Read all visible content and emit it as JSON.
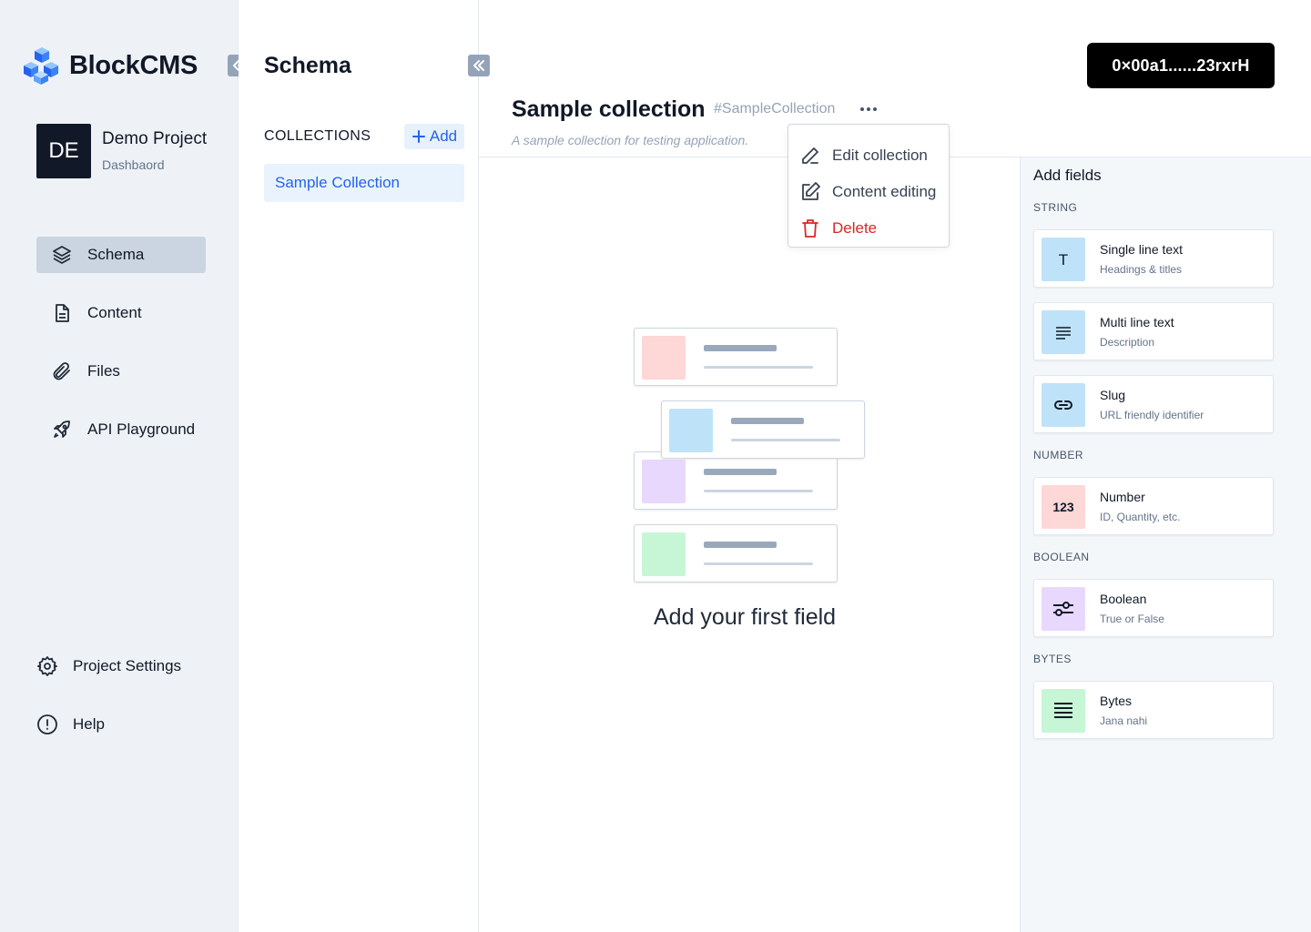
{
  "app": {
    "name": "BlockCMS",
    "wallet_address": "0×00a1......23rxrH"
  },
  "project": {
    "initials": "DE",
    "name": "Demo Project",
    "subtitle": "Dashbaord"
  },
  "sidebar": {
    "items": [
      {
        "label": "Schema",
        "icon": "layers-icon",
        "active": true
      },
      {
        "label": "Content",
        "icon": "document-icon",
        "active": false
      },
      {
        "label": "Files",
        "icon": "paperclip-icon",
        "active": false
      },
      {
        "label": "API Playground",
        "icon": "rocket-icon",
        "active": false
      }
    ],
    "bottom": [
      {
        "label": "Project Settings",
        "icon": "gear-icon"
      },
      {
        "label": "Help",
        "icon": "alert-circle-icon"
      }
    ]
  },
  "schema_panel": {
    "title": "Schema",
    "collections_label": "COLLECTIONS",
    "add_label": "Add",
    "collections": [
      "Sample Collection"
    ]
  },
  "collection": {
    "title": "Sample collection",
    "tag": "#SampleCollection",
    "description": "A sample collection for testing application."
  },
  "menu": {
    "items": [
      {
        "label": "Edit collection",
        "icon": "pencil-icon"
      },
      {
        "label": "Content editing",
        "icon": "edit-square-icon"
      },
      {
        "label": "Delete",
        "icon": "trash-icon",
        "color": "#dc2626"
      }
    ]
  },
  "empty_state": {
    "text": "Add your first field",
    "swatch_colors": [
      "#fed7d7",
      "#bee3f8",
      "#e9d8fd",
      "#c6f6d5"
    ]
  },
  "fields_panel": {
    "title": "Add fields",
    "categories": [
      {
        "name": "STRING",
        "fields": [
          {
            "name": "Single line text",
            "desc": "Headings & titles",
            "icon": "text-t-icon",
            "color": "#bee3f8"
          },
          {
            "name": "Multi line text",
            "desc": "Description",
            "icon": "lines-icon",
            "color": "#bee3f8"
          },
          {
            "name": "Slug",
            "desc": "URL friendly identifier",
            "icon": "link-icon",
            "color": "#bee3f8"
          }
        ]
      },
      {
        "name": "NUMBER",
        "fields": [
          {
            "name": "Number",
            "desc": "ID, Quantity, etc.",
            "icon": "number-123-icon",
            "icon_text": "123",
            "color": "#fed7d7"
          }
        ]
      },
      {
        "name": "BOOLEAN",
        "fields": [
          {
            "name": "Boolean",
            "desc": "True or False",
            "icon": "sliders-icon",
            "color": "#e9d8fd"
          }
        ]
      },
      {
        "name": "BYTES",
        "fields": [
          {
            "name": "Bytes",
            "desc": "Jana nahi",
            "icon": "binary-icon",
            "color": "#c6f6d5"
          }
        ]
      }
    ]
  }
}
